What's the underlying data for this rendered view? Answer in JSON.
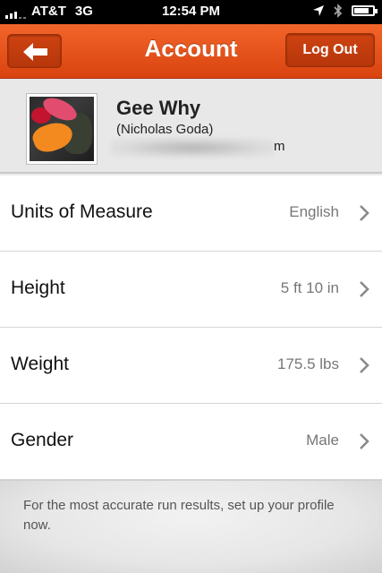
{
  "status_bar": {
    "carrier": "AT&T",
    "network": "3G",
    "time": "12:54 PM"
  },
  "nav": {
    "title": "Account",
    "logout_label": "Log Out",
    "back_icon": "back-arrow-icon",
    "accent_color": "#e4511a"
  },
  "profile": {
    "name": "Gee Why",
    "full_name": "(Nicholas Goda)",
    "email_visible_tail": "m"
  },
  "settings": [
    {
      "label": "Units of Measure",
      "value": "English"
    },
    {
      "label": "Height",
      "value": "5 ft 10 in"
    },
    {
      "label": "Weight",
      "value": "175.5 lbs"
    },
    {
      "label": "Gender",
      "value": "Male"
    }
  ],
  "footer": {
    "note": "For the most accurate run results, set up your profile now."
  }
}
